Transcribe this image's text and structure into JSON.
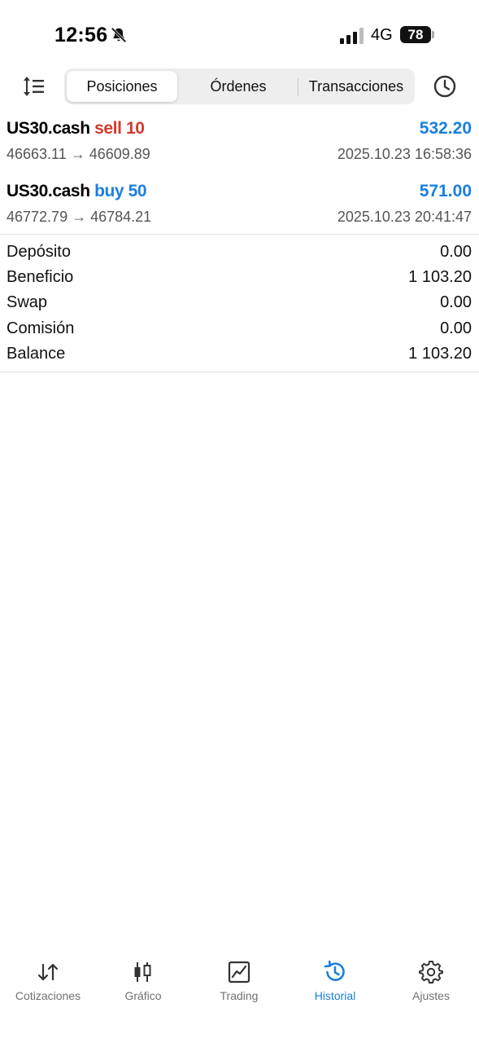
{
  "status_bar": {
    "time": "12:56",
    "network": "4G",
    "battery": "78"
  },
  "toolbar": {
    "tabs": [
      {
        "label": "Posiciones",
        "active": true
      },
      {
        "label": "Órdenes",
        "active": false
      },
      {
        "label": "Transacciones",
        "active": false
      }
    ]
  },
  "trades": [
    {
      "symbol": "US30.cash",
      "side": "sell 10",
      "profit": "532.20",
      "prices": "46663.11 → 46609.89",
      "datetime": "2025.10.23 16:58:36"
    },
    {
      "symbol": "US30.cash",
      "side": "buy 50",
      "profit": "571.00",
      "prices": "46772.79 → 46784.21",
      "datetime": "2025.10.23 20:41:47"
    }
  ],
  "summary": [
    {
      "label": "Depósito",
      "value": "0.00"
    },
    {
      "label": "Beneficio",
      "value": "1 103.20"
    },
    {
      "label": "Swap",
      "value": "0.00"
    },
    {
      "label": "Comisión",
      "value": "0.00"
    },
    {
      "label": "Balance",
      "value": "1 103.20"
    }
  ],
  "nav": [
    {
      "label": "Cotizaciones",
      "icon": "quotes-icon",
      "active": false
    },
    {
      "label": "Gráfico",
      "icon": "chart-icon",
      "active": false
    },
    {
      "label": "Trading",
      "icon": "trading-icon",
      "active": false
    },
    {
      "label": "Historial",
      "icon": "history-icon",
      "active": true
    },
    {
      "label": "Ajustes",
      "icon": "settings-icon",
      "active": false
    }
  ],
  "colors": {
    "accent": "#1a7fe0",
    "sell": "#d33a2c",
    "text_secondary": "#555555"
  }
}
